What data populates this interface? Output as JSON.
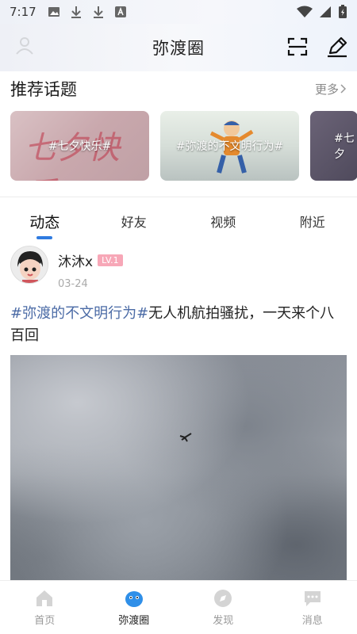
{
  "status_bar": {
    "time": "7:17"
  },
  "header": {
    "title": "弥渡圈"
  },
  "topics": {
    "title": "推荐话题",
    "more_label": "更多",
    "cards": [
      {
        "label": "#七夕快乐#",
        "deco_text": "七夕快乐"
      },
      {
        "label": "#弥渡的不文明行为#"
      },
      {
        "label": "#七夕"
      }
    ]
  },
  "tabs": [
    {
      "label": "动态",
      "active": true
    },
    {
      "label": "好友"
    },
    {
      "label": "视频"
    },
    {
      "label": "附近"
    }
  ],
  "post": {
    "user_name": "沐沐x",
    "level": "LV.1",
    "date": "03-24",
    "hashtag": "#弥渡的不文明行为#",
    "text": "无人机航拍骚扰，一天来个八百回"
  },
  "bottom_nav": [
    {
      "label": "首页",
      "icon": "home-icon"
    },
    {
      "label": "弥渡圈",
      "icon": "circle-icon",
      "active": true
    },
    {
      "label": "发现",
      "icon": "discover-icon"
    },
    {
      "label": "消息",
      "icon": "message-icon"
    }
  ],
  "colors": {
    "accent": "#2f7be0",
    "hashtag": "#4b6ba6",
    "level_badge": "#f7a7b7"
  }
}
